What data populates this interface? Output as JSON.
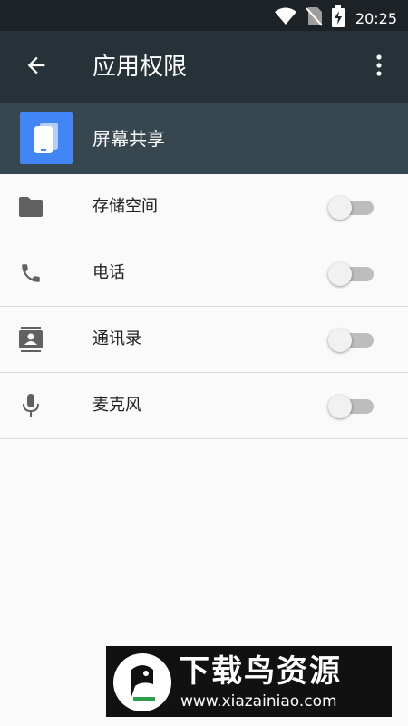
{
  "status_bar": {
    "time": "20:25",
    "icons": [
      "wifi-icon",
      "no-sim-icon",
      "battery-charging-icon"
    ]
  },
  "toolbar": {
    "title": "应用权限",
    "back_icon": "arrow-back-icon",
    "overflow_icon": "more-vert-icon"
  },
  "app": {
    "name": "屏幕共享",
    "icon": "screen-share-app-icon",
    "icon_color": "#4285f4"
  },
  "permissions": [
    {
      "label": "存储空间",
      "icon": "folder-icon",
      "enabled": false
    },
    {
      "label": "电话",
      "icon": "phone-icon",
      "enabled": false
    },
    {
      "label": "通讯录",
      "icon": "contacts-icon",
      "enabled": false
    },
    {
      "label": "麦克风",
      "icon": "microphone-icon",
      "enabled": false
    }
  ],
  "watermark": {
    "title": "下载鸟资源",
    "url": "www.xiazainiao.com"
  },
  "colors": {
    "toolbar": "#263238",
    "header": "#37474f",
    "status_bar": "#1c2226"
  }
}
